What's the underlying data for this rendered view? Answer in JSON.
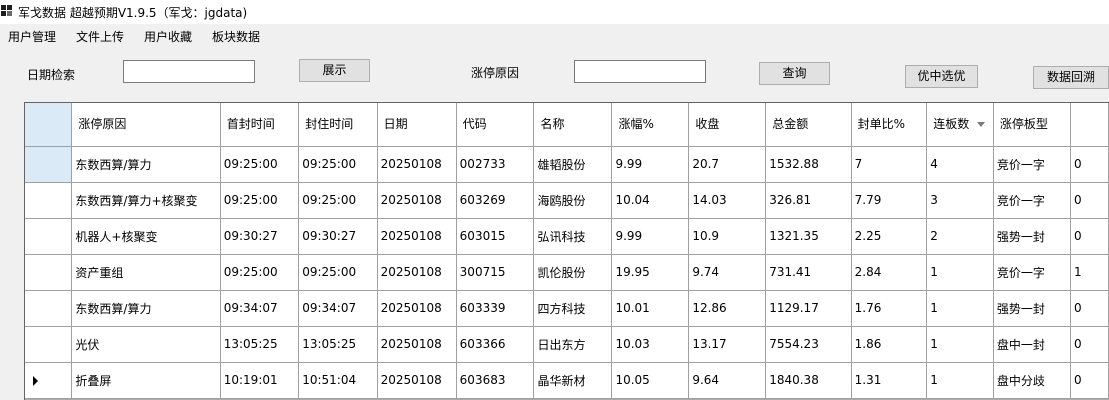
{
  "window": {
    "title": "军戈数据 超越预期V1.9.5（军戈：jgdata)"
  },
  "menu": [
    "用户管理",
    "文件上传",
    "用户收藏",
    "板块数据"
  ],
  "toolbar": {
    "date_label": "日期检索",
    "date_value": "",
    "show_button": "展示",
    "reason_label": "涨停原因",
    "reason_value": "",
    "query_button": "查询",
    "select_button": "优中选优",
    "backtrack_button": "数据回溯"
  },
  "table": {
    "columns": [
      "涨停原因",
      "首封时间",
      "封住时间",
      "日期",
      "代码",
      "名称",
      "涨幅%",
      "收盘",
      "总金额",
      "封单比%",
      "连板数",
      "涨停板型",
      ""
    ],
    "rows": [
      [
        "东数西算/算力",
        "09:25:00",
        "09:25:00",
        "20250108",
        "002733",
        "雄韬股份",
        "9.99",
        "20.7",
        "1532.88",
        "7",
        "4",
        "竞价一字",
        "0"
      ],
      [
        "东数西算/算力+核聚变",
        "09:25:00",
        "09:25:00",
        "20250108",
        "603269",
        "海鸥股份",
        "10.04",
        "14.03",
        "326.81",
        "7.79",
        "3",
        "竞价一字",
        "0"
      ],
      [
        "机器人+核聚变",
        "09:30:27",
        "09:30:27",
        "20250108",
        "603015",
        "弘讯科技",
        "9.99",
        "10.9",
        "1321.35",
        "2.25",
        "2",
        "强势一封",
        "0"
      ],
      [
        "资产重组",
        "09:25:00",
        "09:25:00",
        "20250108",
        "300715",
        "凯伦股份",
        "19.95",
        "9.74",
        "731.41",
        "2.84",
        "1",
        "竞价一字",
        "1"
      ],
      [
        "东数西算/算力",
        "09:34:07",
        "09:34:07",
        "20250108",
        "603339",
        "四方科技",
        "10.01",
        "12.86",
        "1129.17",
        "1.76",
        "1",
        "强势一封",
        "0"
      ],
      [
        "光伏",
        "13:05:25",
        "13:05:25",
        "20250108",
        "603366",
        "日出东方",
        "10.03",
        "13.17",
        "7554.23",
        "1.86",
        "1",
        "盘中一封",
        "0"
      ],
      [
        "折叠屏",
        "10:19:01",
        "10:51:04",
        "20250108",
        "603683",
        "晶华新材",
        "10.05",
        "9.64",
        "1840.38",
        "1.31",
        "1",
        "盘中分歧",
        "0"
      ]
    ]
  }
}
